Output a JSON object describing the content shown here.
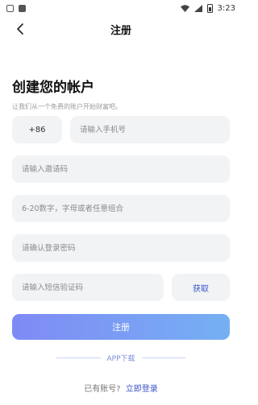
{
  "status_bar": {
    "time": "3:23"
  },
  "nav": {
    "title": "注册"
  },
  "heading": "创建您的帐户",
  "subheading": "让我们从一个免费的账户开始财富吧。",
  "form": {
    "country_code": "+86",
    "phone_placeholder": "请输入手机号",
    "invite_placeholder": "请输入邀请码",
    "password_placeholder": "6-20数字，字母或者任意组合",
    "confirm_placeholder": "请确认登录密码",
    "sms_placeholder": "请输入短信验证码",
    "get_code_label": "获取"
  },
  "submit_label": "注册",
  "download_label": "APP下载",
  "login": {
    "prompt": "已有账号?",
    "link": "立即登录"
  },
  "colors": {
    "accent": "#3a55c8",
    "gradient_start": "#7f8af5",
    "gradient_end": "#75b0f3",
    "field_bg": "#f2f3f5"
  }
}
